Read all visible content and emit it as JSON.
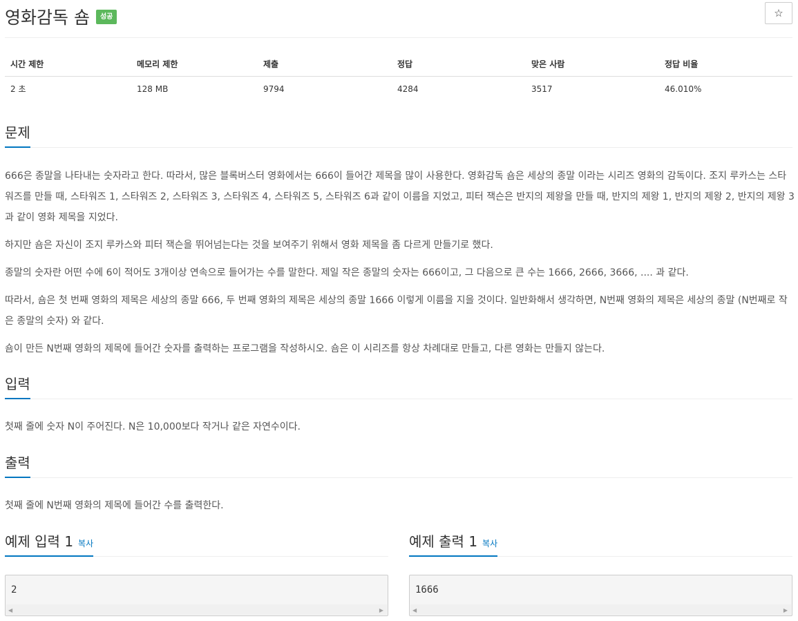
{
  "header": {
    "title": "영화감독 숌",
    "badge": "성공",
    "star": "☆"
  },
  "stats": {
    "headers": [
      "시간 제한",
      "메모리 제한",
      "제출",
      "정답",
      "맞은 사람",
      "정답 비율"
    ],
    "values": [
      "2 초",
      "128 MB",
      "9794",
      "4284",
      "3517",
      "46.010%"
    ]
  },
  "problem": {
    "heading": "문제",
    "paragraphs": [
      "666은 종말을 나타내는 숫자라고 한다. 따라서, 많은 블록버스터 영화에서는 666이 들어간 제목을 많이 사용한다. 영화감독 숌은 세상의 종말 이라는 시리즈 영화의 감독이다. 조지 루카스는 스타워즈를 만들 때, 스타워즈 1, 스타워즈 2, 스타워즈 3, 스타워즈 4, 스타워즈 5, 스타워즈 6과 같이 이름을 지었고, 피터 잭슨은 반지의 제왕을 만들 때, 반지의 제왕 1, 반지의 제왕 2, 반지의 제왕 3과 같이 영화 제목을 지었다.",
      "하지만 숌은 자신이 조지 루카스와 피터 잭슨을 뛰어넘는다는 것을 보여주기 위해서 영화 제목을 좀 다르게 만들기로 했다.",
      "종말의 숫자란 어떤 수에 6이 적어도 3개이상 연속으로 들어가는 수를 말한다. 제일 작은 종말의 숫자는 666이고, 그 다음으로 큰 수는 1666, 2666, 3666, .... 과 같다.",
      "따라서, 숌은 첫 번째 영화의 제목은 세상의 종말 666, 두 번째 영화의 제목은 세상의 종말 1666 이렇게 이름을 지을 것이다. 일반화해서 생각하면, N번째 영화의 제목은 세상의 종말 (N번째로 작은 종말의 숫자) 와 같다.",
      "숌이 만든 N번째 영화의 제목에 들어간 숫자를 출력하는 프로그램을 작성하시오. 숌은 이 시리즈를 항상 차례대로 만들고, 다른 영화는 만들지 않는다."
    ]
  },
  "input": {
    "heading": "입력",
    "text": "첫째 줄에 숫자 N이 주어진다. N은 10,000보다 작거나 같은 자연수이다."
  },
  "output": {
    "heading": "출력",
    "text": "첫째 줄에 N번째 영화의 제목에 들어간 수를 출력한다."
  },
  "samples": {
    "input_heading": "예제 입력 1",
    "output_heading": "예제 출력 1",
    "copy_label": "복사",
    "input_value": "2",
    "output_value": "1666",
    "scroll_left": "◀",
    "scroll_right": "▶"
  },
  "colors": {
    "accent": "#0076c0",
    "success_badge": "#5cb85c"
  }
}
